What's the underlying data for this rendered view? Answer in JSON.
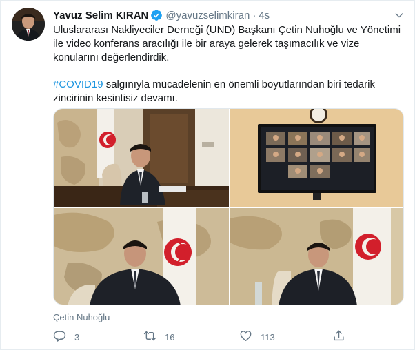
{
  "author": {
    "name": "Yavuz Selim KIRAN",
    "handle": "@yavuzselimkiran",
    "separator": "·",
    "time": "4s",
    "verified": true,
    "verified_color": "#1da1f2"
  },
  "tweet": {
    "paragraph_1": "Uluslararası Nakliyeciler Derneği (UND) Başkanı Çetin Nuhoğlu ve Yönetimi ile video konferans aracılığı ile bir araya gelerek taşımacılık ve vize konularını değerlendirdik.",
    "hashtag": "#COVID19",
    "paragraph_2_rest": " salgınıyla mücadelenin en önemli boyutlarından biri tedarik zincirinin kesintisiz devamı."
  },
  "media": {
    "photos": [
      {
        "subject": "official-at-desk-video-call"
      },
      {
        "subject": "tv-screen-video-conference-grid"
      },
      {
        "subject": "official-seated-map-backdrop"
      },
      {
        "subject": "official-seated-flag-backdrop"
      }
    ],
    "tagged_user": "Çetin Nuhoğlu"
  },
  "actions": {
    "reply_count": "3",
    "retweet_count": "16",
    "like_count": "113"
  },
  "icons": {
    "verified": "verified-badge-icon",
    "caret": "chevron-down-icon",
    "reply": "reply-icon",
    "retweet": "retweet-icon",
    "like": "heart-icon",
    "share": "share-icon",
    "tag": "person-tag-icon"
  },
  "colors": {
    "link": "#1b95e0",
    "secondary_text": "#657786",
    "primary_text": "#14171a",
    "border": "#e6ecf0"
  }
}
